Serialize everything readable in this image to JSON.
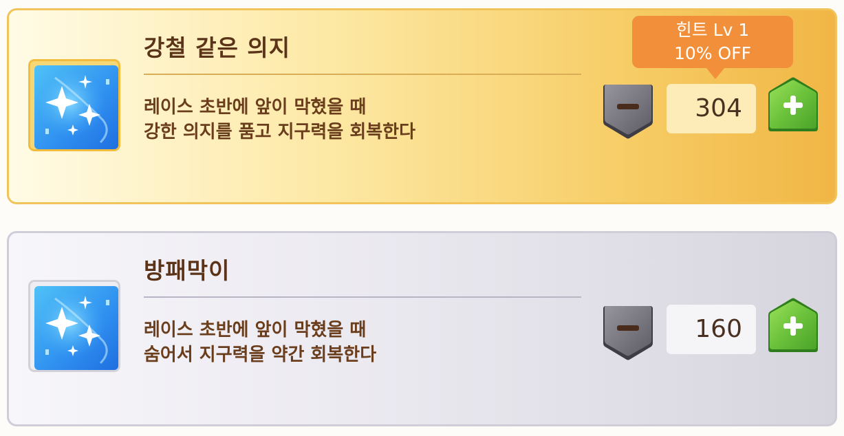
{
  "skills": [
    {
      "title": "강철 같은 의지",
      "desc_line1": "레이스 초반에 앞이 막혔을 때",
      "desc_line2": "강한 의지를 품고 지구력을 회복한다",
      "count": "304",
      "hint_line1": "힌트 Lv 1",
      "hint_line2": "10% OFF",
      "icon": "sparkle-skill-icon",
      "frame": "gold"
    },
    {
      "title": "방패막이",
      "desc_line1": "레이스 초반에 앞이 막혔을 때",
      "desc_line2": "숨어서 지구력을 약간 회복한다",
      "count": "160",
      "icon": "sparkle-skill-icon",
      "frame": "silver"
    }
  ],
  "controls": {
    "minus_icon": "minus-icon",
    "plus_icon": "plus-icon"
  },
  "colors": {
    "gold_accent": "#f0c45a",
    "hint_orange": "#f28f3a",
    "plus_green": "#6cc23b",
    "minus_gray": "#6f6d74",
    "title_brown": "#5a3318"
  }
}
